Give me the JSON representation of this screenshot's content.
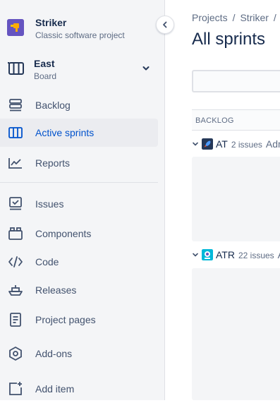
{
  "project": {
    "name": "Striker",
    "type": "Classic software project"
  },
  "board": {
    "name": "East",
    "type": "Board"
  },
  "nav": {
    "backlog": "Backlog",
    "active_sprints": "Active sprints",
    "reports": "Reports",
    "issues": "Issues",
    "components": "Components",
    "code": "Code",
    "releases": "Releases",
    "project_pages": "Project pages",
    "addons": "Add-ons",
    "add_item": "Add item"
  },
  "breadcrumb": {
    "projects": "Projects",
    "sep": "/",
    "project": "Striker",
    "sep2": "/"
  },
  "page": {
    "title": "All sprints"
  },
  "backlog_header": "BACKLOG",
  "sprints": [
    {
      "key": "AT",
      "count": "2 issues",
      "extra": "Adm"
    },
    {
      "key": "ATR",
      "count": "22 issues",
      "extra": "A"
    }
  ],
  "colors": {
    "accent": "#0052CC",
    "sidebar_bg": "#F4F5F7",
    "active_bg": "#EBECF0"
  }
}
